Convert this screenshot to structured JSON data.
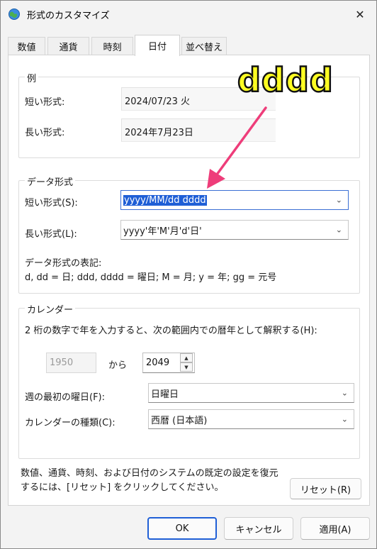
{
  "window": {
    "title": "形式のカスタマイズ",
    "close_glyph": "✕"
  },
  "tabs": [
    {
      "label": "数値",
      "active": false
    },
    {
      "label": "通貨",
      "active": false
    },
    {
      "label": "時刻",
      "active": false
    },
    {
      "label": "日付",
      "active": true
    },
    {
      "label": "並べ替え",
      "active": false
    }
  ],
  "example": {
    "group_label": "例",
    "short_label": "短い形式:",
    "short_value": "2024/07/23 火",
    "long_label": "長い形式:",
    "long_value": "2024年7月23日"
  },
  "data_format": {
    "group_label": "データ形式",
    "short_label": "短い形式(S):",
    "short_value": "yyyy/MM/dd dddd",
    "long_label": "長い形式(L):",
    "long_value": "yyyy'年'M'月'd'日'",
    "notation_title": "データ形式の表記:",
    "notation_text": "d, dd = 日;  ddd, dddd = 曜日; M = 月; y = 年; gg = 元号"
  },
  "calendar": {
    "group_label": "カレンダー",
    "description": "2 桁の数字で年を入力すると、次の範囲内での暦年として解釈する(H):",
    "from_value": "1950",
    "from_to_label": "から",
    "to_value": "2049",
    "first_day_label": "週の最初の曜日(F):",
    "first_day_value": "日曜日",
    "type_label": "カレンダーの種類(C):",
    "type_value": "西暦 (日本語)"
  },
  "footer": {
    "reset_note_line1": "数値、通貨、時刻、および日付のシステムの既定の設定を復元",
    "reset_note_line2": "するには、[リセット] をクリックしてください。",
    "reset_label": "リセット(R)",
    "ok_label": "OK",
    "cancel_label": "キャンセル",
    "apply_label": "適用(A)"
  },
  "annotation": {
    "text": "dddd",
    "text_color": "#ffff22",
    "arrow_color": "#ee3d7a"
  },
  "icons": {
    "caret": "chevron-down-icon",
    "spin_up": "spin-up-icon",
    "spin_down": "spin-down-icon",
    "window_icon": "globe-settings-icon"
  },
  "colors": {
    "selection": "#1f5fd6",
    "focus_border": "#3b6fd4"
  }
}
